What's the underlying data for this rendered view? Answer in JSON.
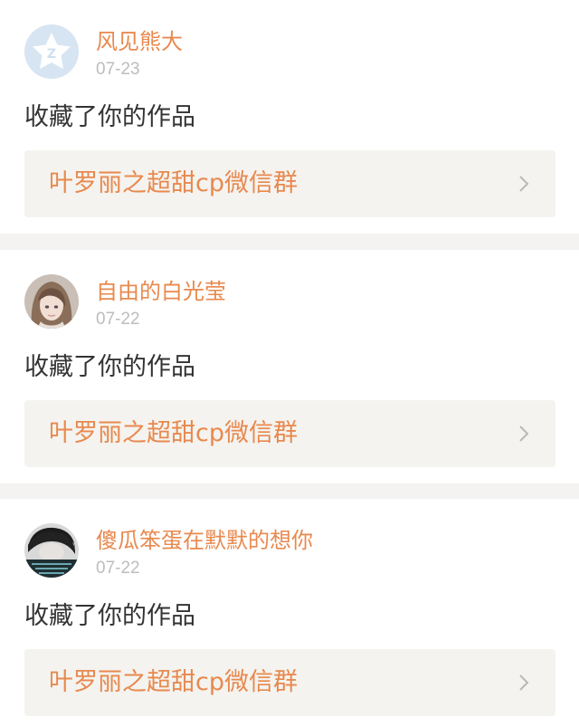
{
  "notifications": [
    {
      "user": "风见熊大",
      "date": "07-23",
      "action": "收藏了你的作品",
      "work_title": "叶罗丽之超甜cp微信群",
      "avatar": "default-qq-star-avatar"
    },
    {
      "user": "自由的白光莹",
      "date": "07-22",
      "action": "收藏了你的作品",
      "work_title": "叶罗丽之超甜cp微信群",
      "avatar": "anime-girl-avatar"
    },
    {
      "user": "傻瓜笨蛋在默默的想你",
      "date": "07-22",
      "action": "收藏了你的作品",
      "work_title": "叶罗丽之超甜cp微信群",
      "avatar": "dark-photo-avatar"
    }
  ],
  "colors": {
    "accent": "#e8894e",
    "date": "#bdbdbd",
    "text": "#333333",
    "link_bg": "#f4f3ef",
    "page_bg": "#f5f3f1"
  }
}
